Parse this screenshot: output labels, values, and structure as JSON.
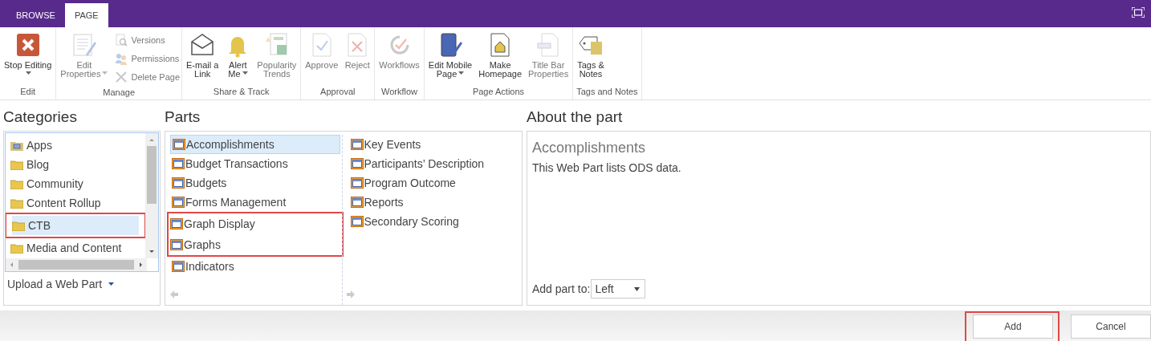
{
  "top_bar": {
    "tabs": [
      {
        "label": "BROWSE",
        "selected": false
      },
      {
        "label": "PAGE",
        "selected": true
      }
    ]
  },
  "ribbon": {
    "groups": [
      {
        "label": "Edit",
        "buttons": [
          {
            "kind": "large",
            "lines": [
              "Stop Editing"
            ],
            "dropdown": true,
            "disabled": false
          }
        ]
      },
      {
        "label": "Manage",
        "buttons": [
          {
            "kind": "large",
            "lines": [
              "Edit",
              "Properties"
            ],
            "dropdown": true,
            "disabled": true
          },
          {
            "kind": "small",
            "lines": [
              "Versions"
            ],
            "dropdown": false,
            "disabled": true
          },
          {
            "kind": "small",
            "lines": [
              "Permissions"
            ],
            "dropdown": false,
            "disabled": true
          },
          {
            "kind": "small",
            "lines": [
              "Delete Page"
            ],
            "dropdown": false,
            "disabled": true
          }
        ]
      },
      {
        "label": "Share & Track",
        "buttons": [
          {
            "kind": "large",
            "lines": [
              "E-mail a",
              "Link"
            ],
            "dropdown": false,
            "disabled": false
          },
          {
            "kind": "large",
            "lines": [
              "Alert",
              "Me"
            ],
            "dropdown": true,
            "disabled": false
          },
          {
            "kind": "large",
            "lines": [
              "Popularity",
              "Trends"
            ],
            "dropdown": false,
            "disabled": true
          }
        ]
      },
      {
        "label": "Approval",
        "buttons": [
          {
            "kind": "large",
            "lines": [
              "Approve"
            ],
            "dropdown": false,
            "disabled": true
          },
          {
            "kind": "large",
            "lines": [
              "Reject"
            ],
            "dropdown": false,
            "disabled": true
          }
        ]
      },
      {
        "label": "Workflow",
        "buttons": [
          {
            "kind": "large",
            "lines": [
              "Workflows"
            ],
            "dropdown": false,
            "disabled": true
          }
        ]
      },
      {
        "label": "Page Actions",
        "buttons": [
          {
            "kind": "large",
            "lines": [
              "Edit Mobile",
              "Page"
            ],
            "dropdown": true,
            "disabled": false
          },
          {
            "kind": "large",
            "lines": [
              "Make",
              "Homepage"
            ],
            "dropdown": false,
            "disabled": false
          },
          {
            "kind": "large",
            "lines": [
              "Title Bar",
              "Properties"
            ],
            "dropdown": false,
            "disabled": true
          }
        ]
      },
      {
        "label": "Tags and Notes",
        "buttons": [
          {
            "kind": "large",
            "lines": [
              "Tags &",
              "Notes"
            ],
            "dropdown": false,
            "disabled": false
          }
        ]
      }
    ]
  },
  "categories": {
    "title": "Categories",
    "items": [
      {
        "kind": "app_folder",
        "label": "Apps",
        "selected": false,
        "highlighted": false
      },
      {
        "kind": "folder",
        "label": "Blog",
        "selected": false,
        "highlighted": false
      },
      {
        "kind": "folder",
        "label": "Community",
        "selected": false,
        "highlighted": false
      },
      {
        "kind": "folder",
        "label": "Content Rollup",
        "selected": false,
        "highlighted": false
      },
      {
        "kind": "folder",
        "label": "CTB",
        "selected": true,
        "highlighted": true
      },
      {
        "kind": "folder",
        "label": "Media and Content",
        "selected": false,
        "highlighted": false
      }
    ],
    "upload_link": "Upload a Web Part"
  },
  "parts": {
    "title": "Parts",
    "columns": [
      [
        {
          "label": "Accomplishments",
          "selected": true,
          "highlighted": false
        },
        {
          "label": "Budget Transactions",
          "selected": false,
          "highlighted": false
        },
        {
          "label": "Budgets",
          "selected": false,
          "highlighted": false
        },
        {
          "label": "Forms Management",
          "selected": false,
          "highlighted": false
        },
        {
          "label": "Graph Display",
          "selected": false,
          "highlighted": true
        },
        {
          "label": "Graphs",
          "selected": false,
          "highlighted": true
        },
        {
          "label": "Indicators",
          "selected": false,
          "highlighted": false
        }
      ],
      [
        {
          "label": "Key Events",
          "selected": false,
          "highlighted": false
        },
        {
          "label": "Participants’ Description",
          "selected": false,
          "highlighted": false
        },
        {
          "label": "Program Outcome",
          "selected": false,
          "highlighted": false
        },
        {
          "label": "Reports",
          "selected": false,
          "highlighted": false
        },
        {
          "label": "Secondary Scoring",
          "selected": false,
          "highlighted": false
        }
      ]
    ]
  },
  "about": {
    "title": "About the part",
    "part_name": "Accomplishments",
    "description": "This Web Part lists ODS data.",
    "add_to_label": "Add part to:",
    "add_to_value": "Left"
  },
  "buttons": [
    {
      "label": "Add",
      "highlighted": true
    },
    {
      "label": "Cancel",
      "highlighted": false
    }
  ]
}
